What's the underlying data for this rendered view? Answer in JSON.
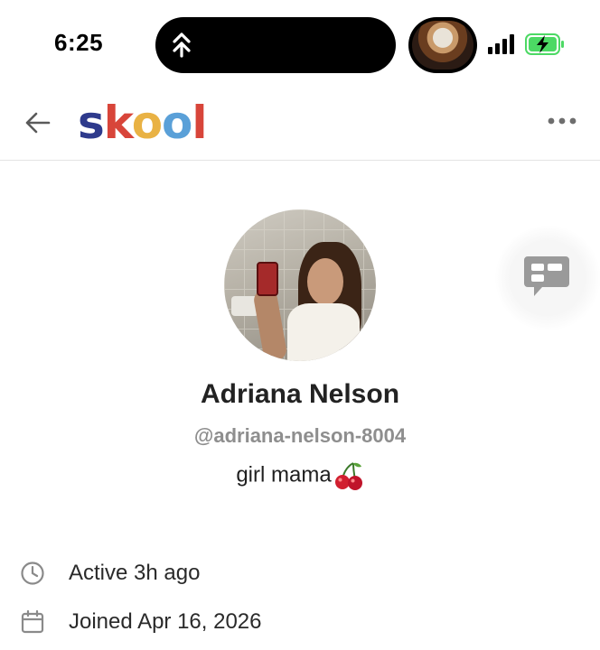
{
  "status_bar": {
    "time": "6:25",
    "battery_charging": true
  },
  "header": {
    "logo_letters": [
      "s",
      "k",
      "o",
      "o",
      "l"
    ],
    "logo_colors": [
      "#2e3a8c",
      "#d8453a",
      "#e9b244",
      "#5aa0d8",
      "#d8453a"
    ],
    "back_icon": "arrow-left-icon",
    "more_icon": "more-horizontal-icon"
  },
  "profile": {
    "name": "Adriana Nelson",
    "handle": "@adriana-nelson-8004",
    "bio": "girl mama",
    "bio_emoji": "cherries-emoji",
    "chat_icon": "chat-bubble-icon"
  },
  "meta": {
    "active": "Active 3h ago",
    "joined": "Joined Apr 16, 2026",
    "active_icon": "clock-icon",
    "joined_icon": "calendar-icon"
  },
  "colors": {
    "muted_text": "#8e8e8e",
    "battery_green": "#4cd964"
  }
}
